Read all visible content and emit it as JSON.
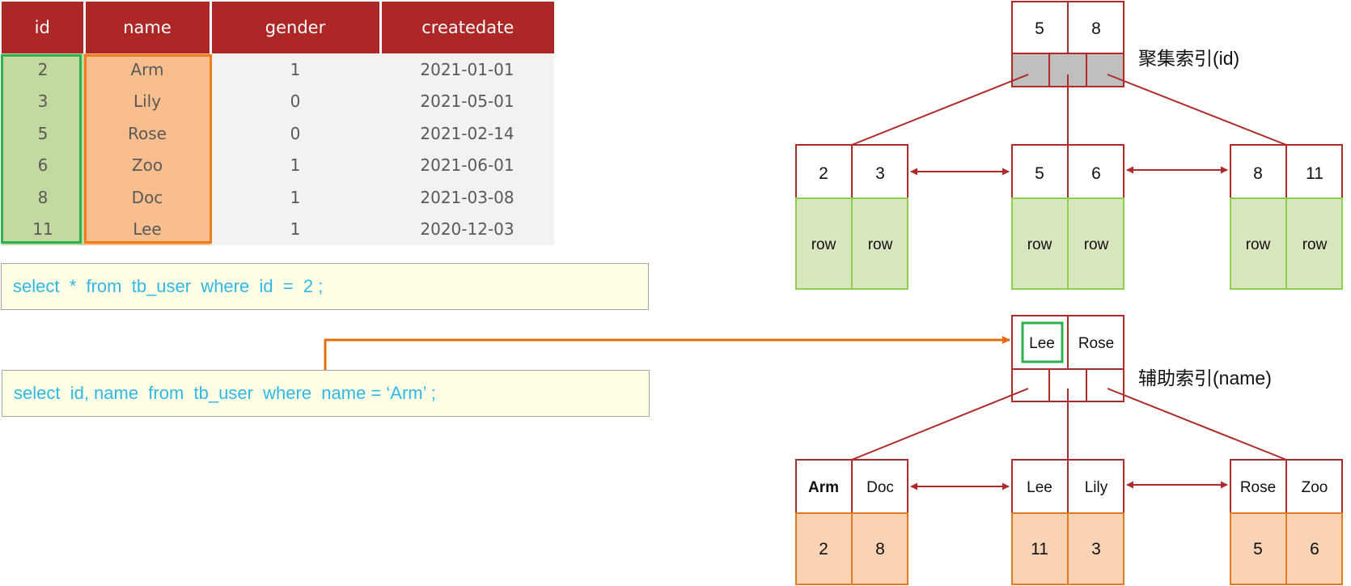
{
  "table": {
    "headers": [
      "id",
      "name",
      "gender",
      "createdate"
    ],
    "rows": [
      [
        "2",
        "Arm",
        "1",
        "2021-01-01"
      ],
      [
        "3",
        "Lily",
        "0",
        "2021-05-01"
      ],
      [
        "5",
        "Rose",
        "0",
        "2021-02-14"
      ],
      [
        "6",
        "Zoo",
        "1",
        "2021-06-01"
      ],
      [
        "8",
        "Doc",
        "1",
        "2021-03-08"
      ],
      [
        "11",
        "Lee",
        "1",
        "2020-12-03"
      ]
    ]
  },
  "queries": {
    "q1": "select  *  from  tb_user  where  id  =  2 ;",
    "q2": "select  id, name  from  tb_user  where  name = ‘Arm’ ;"
  },
  "clustered": {
    "label": "聚集索引(id)",
    "root": [
      "5",
      "8"
    ],
    "leaves": [
      {
        "keys": [
          "2",
          "3"
        ],
        "values": [
          "row",
          "row"
        ]
      },
      {
        "keys": [
          "5",
          "6"
        ],
        "values": [
          "row",
          "row"
        ]
      },
      {
        "keys": [
          "8",
          "11"
        ],
        "values": [
          "row",
          "row"
        ]
      }
    ]
  },
  "secondary": {
    "label": "辅助索引(name)",
    "root": [
      "Lee",
      "Rose"
    ],
    "leaves": [
      {
        "keys": [
          "Arm",
          "Doc"
        ],
        "values": [
          "2",
          "8"
        ]
      },
      {
        "keys": [
          "Lee",
          "Lily"
        ],
        "values": [
          "11",
          "3"
        ]
      },
      {
        "keys": [
          "Rose",
          "Zoo"
        ],
        "values": [
          "5",
          "6"
        ]
      }
    ]
  },
  "colors": {
    "header": "#ad2727",
    "id_highlight": "#2fb04e",
    "name_highlight": "#ed7d1f",
    "node_border": "#b02a2a",
    "row_fill": "#d8e6bf",
    "row_border": "#8fcf4f",
    "pk_fill": "#f9d3b4",
    "pk_border": "#e57a22",
    "sql_text": "#30b7e8"
  }
}
